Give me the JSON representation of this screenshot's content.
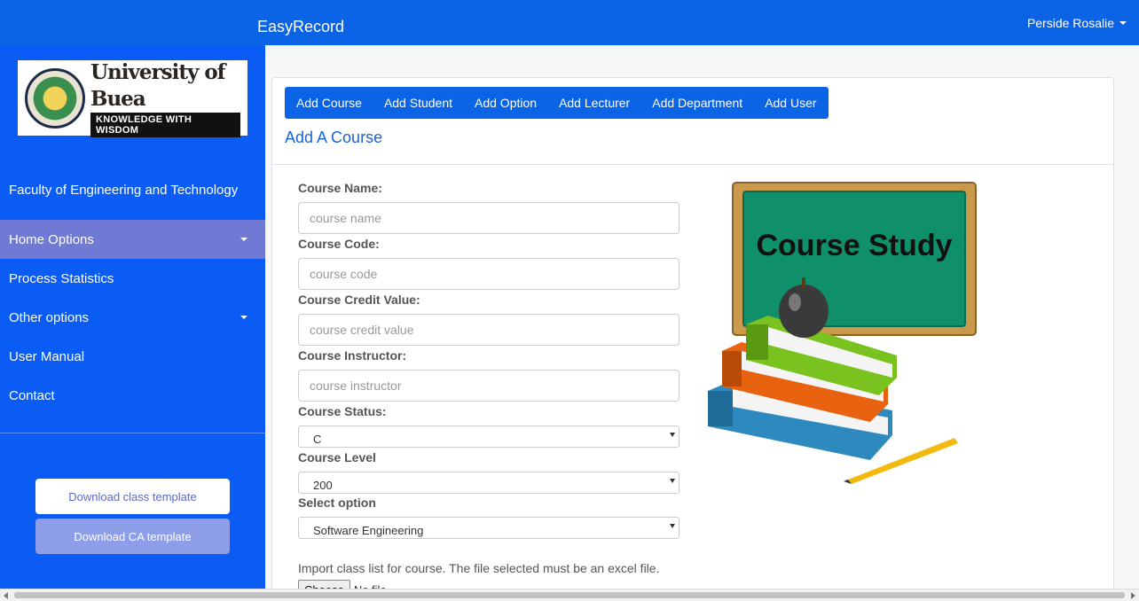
{
  "app": {
    "brand": "EasyRecord",
    "user_name": "Perside Rosalie"
  },
  "sidebar": {
    "logo": {
      "name": "University of Buea",
      "motto": "KNOWLEDGE WITH WISDOM"
    },
    "faculty": "Faculty of Engineering and Technology",
    "items": [
      {
        "label": "Home Options",
        "has_caret": true,
        "active": true
      },
      {
        "label": "Process Statistics",
        "has_caret": false,
        "active": false
      },
      {
        "label": "Other options",
        "has_caret": true,
        "active": false
      },
      {
        "label": "User Manual",
        "has_caret": false,
        "active": false
      },
      {
        "label": "Contact",
        "has_caret": false,
        "active": false
      }
    ],
    "download_class": "Download class template",
    "download_ca": "Download CA template"
  },
  "tabs": [
    "Add Course",
    "Add Student",
    "Add Option",
    "Add Lecturer",
    "Add Department",
    "Add User"
  ],
  "panel_title": "Add A Course",
  "form": {
    "course_name": {
      "label": "Course Name:",
      "placeholder": "course name"
    },
    "course_code": {
      "label": "Course Code:",
      "placeholder": "course code"
    },
    "course_credit": {
      "label": "Course Credit Value:",
      "placeholder": "course credit value"
    },
    "course_instructor": {
      "label": "Course Instructor:",
      "placeholder": "course instructor"
    },
    "course_status": {
      "label": "Course Status:",
      "value": "C"
    },
    "course_level": {
      "label": "Course Level",
      "value": "200"
    },
    "select_option": {
      "label": "Select option",
      "value": "Software Engineering"
    },
    "import_note": "Import class list for course. The file selected must be an excel file.",
    "choose_file": "Choose File",
    "no_file": "No file chosen"
  },
  "illustration": {
    "board_text": "Course Study"
  },
  "colors": {
    "primary": "#0b63e5",
    "sidebar": "#0b5cf5",
    "active": "#7079d4"
  }
}
